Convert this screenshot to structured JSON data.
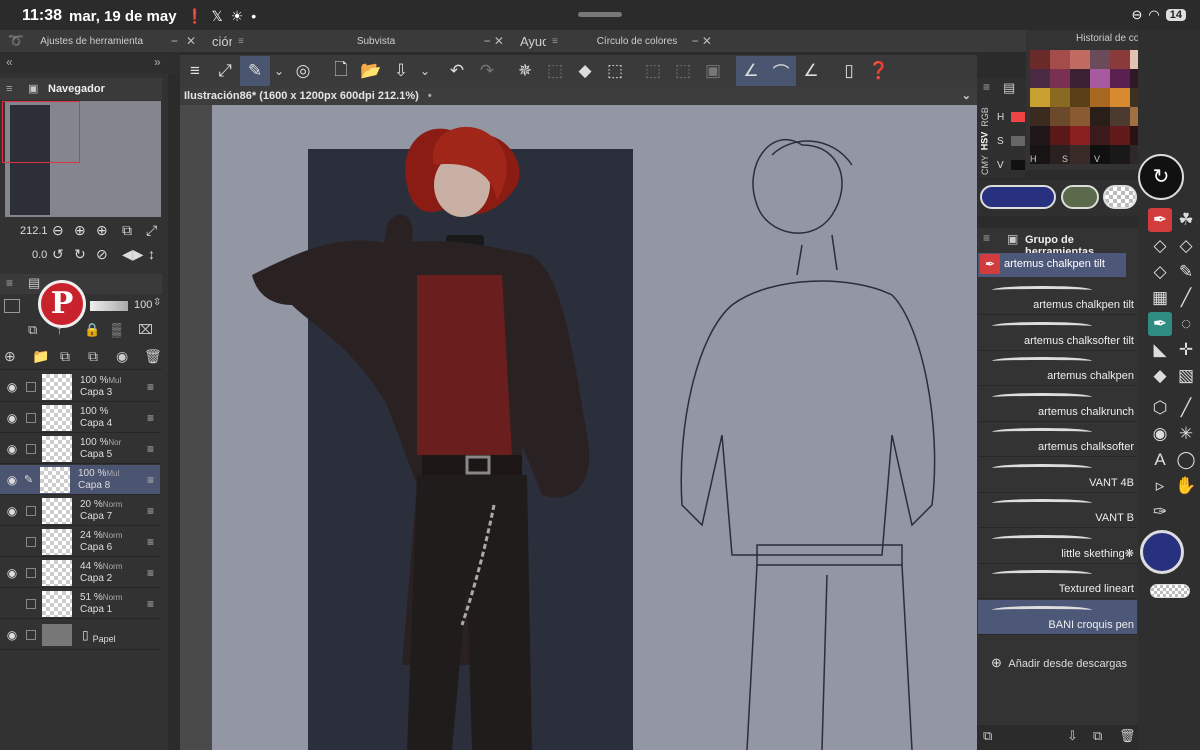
{
  "status": {
    "time": "11:38",
    "date": "mar, 19 de may",
    "battery": "14"
  },
  "tabs": {
    "tool_settings": "Ajustes de herramienta",
    "subview": "Subvista",
    "color_wheel": "Círculo de colores",
    "color_history": "Historial de color",
    "partial_left": "ción",
    "partial_help": "Ayud",
    "navigator": "Navegador",
    "tool_group": "Grupo de herramientas"
  },
  "canvas": {
    "title": "Ilustración86* (1600 x 1200px 600dpi 212.1%)"
  },
  "navigator": {
    "zoom": "212.1",
    "rotation": "0.0"
  },
  "layer_panel": {
    "opacity": "100"
  },
  "layers": [
    {
      "pct": "100 %",
      "mode": "Mul",
      "name": "Capa 3",
      "visible": true,
      "selected": false
    },
    {
      "pct": "100 %",
      "mode": "",
      "name": "Capa 4",
      "visible": true,
      "selected": false
    },
    {
      "pct": "100 %",
      "mode": "Nor",
      "name": "Capa 5",
      "visible": true,
      "selected": false
    },
    {
      "pct": "100 %",
      "mode": "Mul",
      "name": "Capa 8",
      "visible": true,
      "selected": true
    },
    {
      "pct": "20 %",
      "mode": "Norm",
      "name": "Capa 7",
      "visible": true,
      "selected": false
    },
    {
      "pct": "24 %",
      "mode": "Norm",
      "name": "Capa 6",
      "visible": false,
      "selected": false
    },
    {
      "pct": "44 %",
      "mode": "Norm",
      "name": "Capa 2",
      "visible": true,
      "selected": false
    },
    {
      "pct": "51 %",
      "mode": "Norm",
      "name": "Capa 1",
      "visible": false,
      "selected": false
    },
    {
      "pct": "",
      "mode": "",
      "name": "Papel",
      "visible": true,
      "selected": false
    }
  ],
  "color_panel": {
    "modes": [
      "RGB",
      "HSV",
      "CMY"
    ],
    "h_label": "H",
    "s_label": "S",
    "v_label": "V",
    "main_color": "#283080",
    "sub_color": "#5a6a4a"
  },
  "brushes": {
    "header": "artemus chalkpen tilt",
    "items": [
      "artemus chalkpen tilt",
      "artemus chalksofter tilt",
      "artemus chalkpen",
      "artemus chalkrunch",
      "artemus chalksofter",
      "VANT 4B",
      "VANT B",
      "little skething❋",
      "Textured lineart",
      "BANI croquis pen"
    ],
    "add_label": "Añadir desde descargas"
  },
  "swatches": [
    "#6b2a2a",
    "#a44c4a",
    "#c06a60",
    "#6b4a5a",
    "#8a3a3a",
    "#e2c2b2",
    "#b46a70",
    "#d8b0a6",
    "#4a2a40",
    "#7a3050",
    "#3a2030",
    "#a85aa0",
    "#5a2050",
    "#301828",
    "#2a1a22",
    "#1e1418",
    "#c8a030",
    "#8a6a20",
    "#5a4018",
    "#a86820",
    "#d88a30",
    "#403020",
    "#2a2018",
    "#1a1410",
    "#3a2a20",
    "#6a4a2a",
    "#8a5a30",
    "#2a1e18",
    "#4a3a30",
    "#a07040",
    "#b89050",
    "#1c1410",
    "#201818",
    "#5a1818",
    "#8a2020",
    "#3a1a1a",
    "#601a1a",
    "#2a1010",
    "#4a1a10",
    "#7a2a20",
    "#181414",
    "#2a2020",
    "#3a2a28",
    "#101010",
    "#1a1818",
    "#302828",
    "#403030",
    "#221c1c"
  ]
}
